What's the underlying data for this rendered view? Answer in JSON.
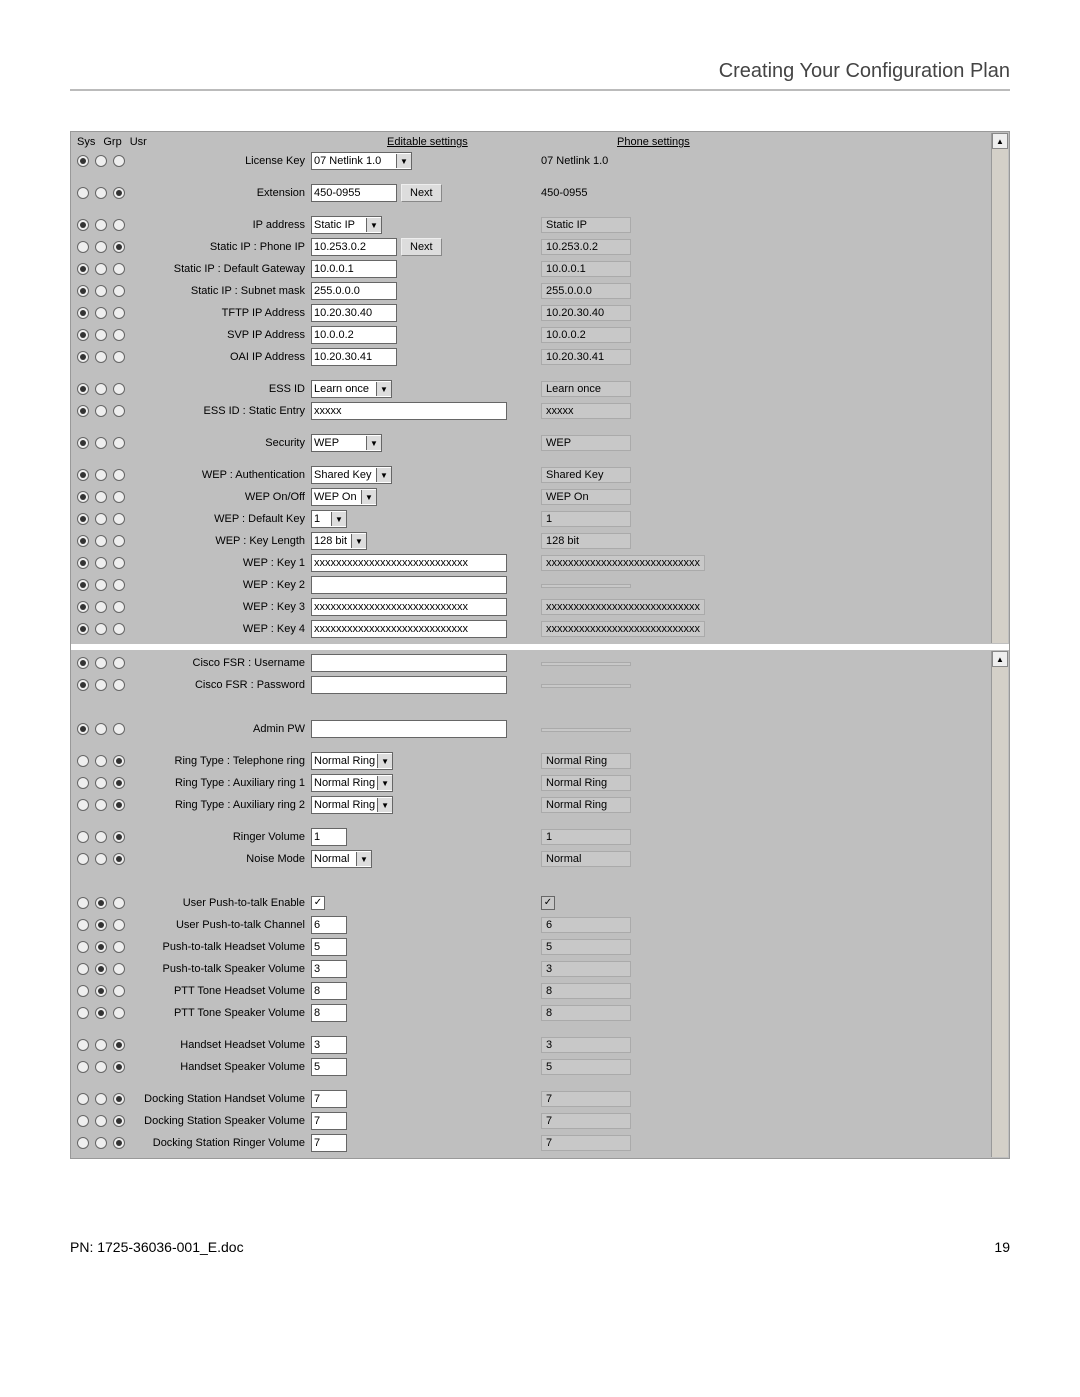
{
  "page": {
    "header_title": "Creating Your Configuration Plan",
    "footer_left": "PN: 1725-36036-001_E.doc",
    "footer_right": "19"
  },
  "headers": {
    "sys": "Sys",
    "grp": "Grp",
    "usr": "Usr",
    "editable": "Editable settings",
    "phone": "Phone settings"
  },
  "buttons": {
    "next1": "Next",
    "next2": "Next"
  },
  "panel1": {
    "rows": [
      {
        "sel": 0,
        "label": "License Key",
        "type": "dropdown",
        "value": "07 Netlink 1.0",
        "phone": "07 Netlink 1.0",
        "phoneBoxed": false,
        "dd_w": 80,
        "spacer_after": true
      },
      {
        "sel": 2,
        "label": "Extension",
        "type": "text",
        "value": "450-0955",
        "w": "w80",
        "phone": "450-0955",
        "phoneBoxed": false,
        "btn": "next1",
        "spacer_after": true
      },
      {
        "sel": 0,
        "label": "IP address",
        "type": "dropdown",
        "value": "Static IP",
        "phone": "Static IP",
        "phoneBoxed": true,
        "dd_w": 50
      },
      {
        "sel": 2,
        "label": "Static IP : Phone IP",
        "type": "text",
        "value": "10.253.0.2",
        "w": "w80",
        "phone": "10.253.0.2",
        "phoneBoxed": true,
        "btn": "next2"
      },
      {
        "sel": 0,
        "label": "Static IP : Default Gateway",
        "type": "text",
        "value": "10.0.0.1",
        "w": "w80",
        "phone": "10.0.0.1",
        "phoneBoxed": true
      },
      {
        "sel": 0,
        "label": "Static IP : Subnet mask",
        "type": "text",
        "value": "255.0.0.0",
        "w": "w80",
        "phone": "255.0.0.0",
        "phoneBoxed": true
      },
      {
        "sel": 0,
        "label": "TFTP IP Address",
        "type": "text",
        "value": "10.20.30.40",
        "w": "w80",
        "phone": "10.20.30.40",
        "phoneBoxed": true
      },
      {
        "sel": 0,
        "label": "SVP IP Address",
        "type": "text",
        "value": "10.0.0.2",
        "w": "w80",
        "phone": "10.0.0.2",
        "phoneBoxed": true
      },
      {
        "sel": 0,
        "label": "OAI IP Address",
        "type": "text",
        "value": "10.20.30.41",
        "w": "w80",
        "phone": "10.20.30.41",
        "phoneBoxed": true,
        "spacer_after": true
      },
      {
        "sel": 0,
        "label": "ESS ID",
        "type": "dropdown",
        "value": "Learn once",
        "phone": "Learn once",
        "phoneBoxed": true,
        "dd_w": 60
      },
      {
        "sel": 0,
        "label": "ESS ID : Static Entry",
        "type": "text",
        "value": "xxxxx",
        "w": "w180",
        "phone": "xxxxx",
        "phoneBoxed": true,
        "spacer_after": true
      },
      {
        "sel": 0,
        "label": "Security",
        "type": "dropdown",
        "value": "WEP",
        "phone": "WEP",
        "phoneBoxed": true,
        "dd_w": 50,
        "spacer_after": true
      },
      {
        "sel": 0,
        "label": "WEP : Authentication",
        "type": "dropdown",
        "value": "Shared Key",
        "phone": "Shared Key",
        "phoneBoxed": true,
        "dd_w": 60
      },
      {
        "sel": 0,
        "label": "WEP On/Off",
        "type": "dropdown",
        "value": "WEP On",
        "phone": "WEP On",
        "phoneBoxed": true,
        "dd_w": 45
      },
      {
        "sel": 0,
        "label": "WEP : Default Key",
        "type": "dropdown",
        "value": "1",
        "phone": "1",
        "phoneBoxed": true,
        "dd_w": 15
      },
      {
        "sel": 0,
        "label": "WEP : Key Length",
        "type": "dropdown",
        "value": "128 bit",
        "phone": "128 bit",
        "phoneBoxed": true,
        "dd_w": 35
      },
      {
        "sel": 0,
        "label": "WEP : Key 1",
        "type": "text",
        "value": "xxxxxxxxxxxxxxxxxxxxxxxxxxxx",
        "w": "w180",
        "phone": "xxxxxxxxxxxxxxxxxxxxxxxxxxxx",
        "phoneBoxed": true
      },
      {
        "sel": 0,
        "label": "WEP : Key 2",
        "type": "text",
        "value": "",
        "w": "w180",
        "phone": "",
        "phoneBoxed": true
      },
      {
        "sel": 0,
        "label": "WEP : Key 3",
        "type": "text",
        "value": "xxxxxxxxxxxxxxxxxxxxxxxxxxxx",
        "w": "w180",
        "phone": "xxxxxxxxxxxxxxxxxxxxxxxxxxxx",
        "phoneBoxed": true
      },
      {
        "sel": 0,
        "label": "WEP : Key 4",
        "type": "text",
        "value": "xxxxxxxxxxxxxxxxxxxxxxxxxxxx",
        "w": "w180",
        "phone": "xxxxxxxxxxxxxxxxxxxxxxxxxxxx",
        "phoneBoxed": true
      }
    ]
  },
  "panel2": {
    "rows": [
      {
        "sel": 0,
        "label": "Cisco FSR : Username",
        "type": "text",
        "value": "",
        "w": "w180",
        "phone": "",
        "phoneBoxed": true
      },
      {
        "sel": 0,
        "label": "Cisco FSR : Password",
        "type": "text",
        "value": "",
        "w": "w180",
        "phone": "",
        "phoneBoxed": true,
        "spacer_after": true,
        "spacer_big": true
      },
      {
        "sel": 0,
        "label": "Admin PW",
        "type": "text",
        "value": "",
        "w": "w180",
        "phone": "",
        "phoneBoxed": true,
        "spacer_after": true
      },
      {
        "sel": 2,
        "label": "Ring Type : Telephone ring",
        "type": "dropdown",
        "value": "Normal Ring",
        "phone": "Normal Ring",
        "phoneBoxed": true,
        "dd_w": 60
      },
      {
        "sel": 2,
        "label": "Ring Type : Auxiliary ring 1",
        "type": "dropdown",
        "value": "Normal Ring",
        "phone": "Normal Ring",
        "phoneBoxed": true,
        "dd_w": 60
      },
      {
        "sel": 2,
        "label": "Ring Type : Auxiliary ring 2",
        "type": "dropdown",
        "value": "Normal Ring",
        "phone": "Normal Ring",
        "phoneBoxed": true,
        "dd_w": 60,
        "spacer_after": true
      },
      {
        "sel": 2,
        "label": "Ringer Volume",
        "type": "text",
        "value": "1",
        "w": "w30",
        "phone": "1",
        "phoneBoxed": true
      },
      {
        "sel": 2,
        "label": "Noise Mode",
        "type": "dropdown",
        "value": "Normal",
        "phone": "Normal",
        "phoneBoxed": true,
        "dd_w": 40,
        "spacer_after": true,
        "spacer_big": true
      },
      {
        "sel": 1,
        "label": "User Push-to-talk Enable",
        "type": "checkbox",
        "checked": true,
        "phone": "✓",
        "phoneBoxed": true,
        "phone_is_check": true
      },
      {
        "sel": 1,
        "label": "User Push-to-talk Channel",
        "type": "text",
        "value": "6",
        "w": "w30",
        "phone": "6",
        "phoneBoxed": true
      },
      {
        "sel": 1,
        "label": "Push-to-talk Headset Volume",
        "type": "text",
        "value": "5",
        "w": "w30",
        "phone": "5",
        "phoneBoxed": true
      },
      {
        "sel": 1,
        "label": "Push-to-talk Speaker Volume",
        "type": "text",
        "value": "3",
        "w": "w30",
        "phone": "3",
        "phoneBoxed": true
      },
      {
        "sel": 1,
        "label": "PTT Tone Headset Volume",
        "type": "text",
        "value": "8",
        "w": "w30",
        "phone": "8",
        "phoneBoxed": true
      },
      {
        "sel": 1,
        "label": "PTT Tone Speaker Volume",
        "type": "text",
        "value": "8",
        "w": "w30",
        "phone": "8",
        "phoneBoxed": true,
        "spacer_after": true
      },
      {
        "sel": 2,
        "label": "Handset Headset Volume",
        "type": "text",
        "value": "3",
        "w": "w30",
        "phone": "3",
        "phoneBoxed": true
      },
      {
        "sel": 2,
        "label": "Handset Speaker Volume",
        "type": "text",
        "value": "5",
        "w": "w30",
        "phone": "5",
        "phoneBoxed": true,
        "spacer_after": true
      },
      {
        "sel": 2,
        "label": "Docking Station Handset Volume",
        "type": "text",
        "value": "7",
        "w": "w30",
        "phone": "7",
        "phoneBoxed": true
      },
      {
        "sel": 2,
        "label": "Docking Station Speaker Volume",
        "type": "text",
        "value": "7",
        "w": "w30",
        "phone": "7",
        "phoneBoxed": true
      },
      {
        "sel": 2,
        "label": "Docking Station Ringer Volume",
        "type": "text",
        "value": "7",
        "w": "w30",
        "phone": "7",
        "phoneBoxed": true
      }
    ]
  }
}
